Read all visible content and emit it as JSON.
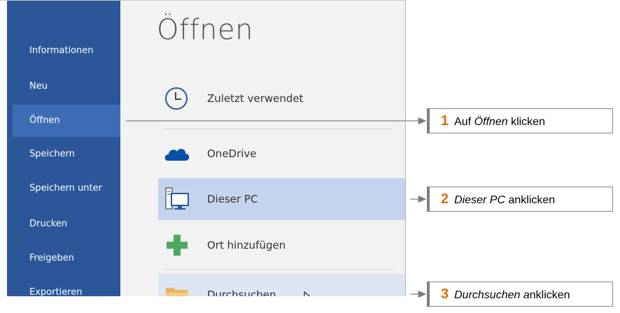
{
  "sidebar": {
    "items": [
      {
        "label": "Informationen"
      },
      {
        "label": "Neu"
      },
      {
        "label": "Öffnen",
        "active": true
      },
      {
        "label": "Speichern"
      },
      {
        "label": "Speichern unter"
      },
      {
        "label": "Drucken"
      },
      {
        "label": "Freigeben"
      },
      {
        "label": "Exportieren"
      }
    ]
  },
  "main": {
    "title": "Öffnen",
    "places": [
      {
        "label": "Zuletzt verwendet",
        "icon": "clock-icon"
      },
      {
        "label": "OneDrive",
        "icon": "cloud-icon"
      },
      {
        "label": "Dieser PC",
        "icon": "computer-icon",
        "state": "selected"
      },
      {
        "label": "Ort hinzufügen",
        "icon": "plus-icon"
      },
      {
        "label": "Durchsuchen",
        "icon": "folder-icon",
        "state": "hover"
      }
    ]
  },
  "callouts": [
    {
      "number": "1",
      "pre": "Auf ",
      "emph": "Öffnen",
      "post": " klicken"
    },
    {
      "number": "2",
      "pre": "",
      "emph": "Dieser PC",
      "post": " anklicken"
    },
    {
      "number": "3",
      "pre": "",
      "emph": "Durchsuchen a",
      "post": "nklicken"
    }
  ],
  "colors": {
    "sidebar": "#2b579a",
    "sidebar_active": "#3e6db5",
    "selected": "#c5d4ee",
    "hover": "#dde6f5",
    "callout_number": "#e36c0a"
  }
}
